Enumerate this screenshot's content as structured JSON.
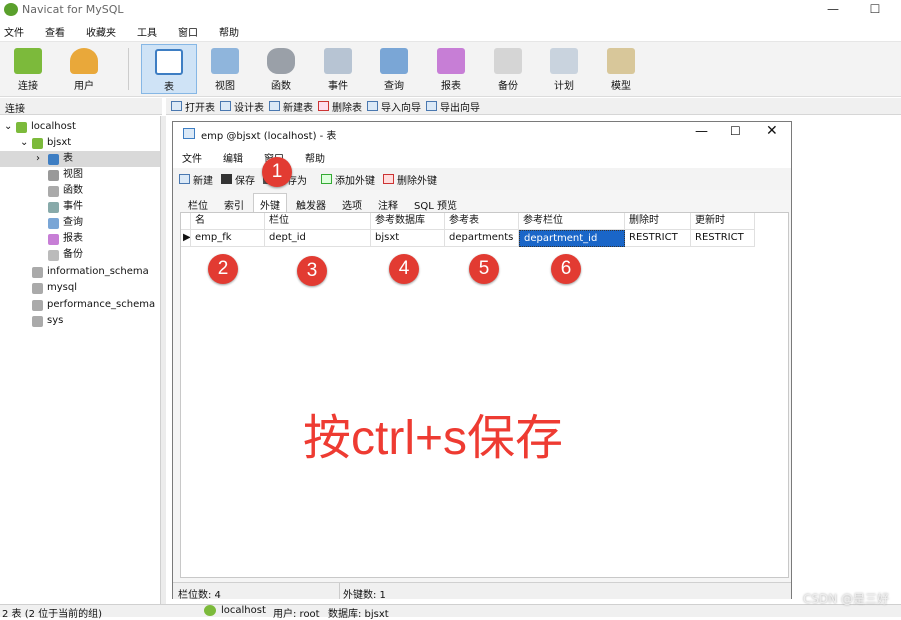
{
  "window": {
    "title": "Navicat for MySQL",
    "minimize": "—",
    "maximize": "☐"
  },
  "menu": [
    "文件",
    "查看",
    "收藏夹",
    "工具",
    "窗口",
    "帮助"
  ],
  "toolbar": [
    "连接",
    "用户",
    "表",
    "视图",
    "函数",
    "事件",
    "查询",
    "报表",
    "备份",
    "计划",
    "模型"
  ],
  "connections_header": "连接",
  "objbar": [
    "打开表",
    "设计表",
    "新建表",
    "删除表",
    "导入向导",
    "导出向导"
  ],
  "tree": {
    "localhost": "localhost",
    "bjsxt": "bjsxt",
    "table": "表",
    "view": "视图",
    "function": "函数",
    "event": "事件",
    "query": "查询",
    "report": "报表",
    "backup": "备份",
    "other_dbs": [
      "information_schema",
      "mysql",
      "performance_schema",
      "sys"
    ]
  },
  "status": {
    "left": "2 表 (2 位于当前的组)",
    "host": "localhost",
    "user": "用户: root",
    "db": "数据库: bjsxt"
  },
  "dialog": {
    "title": "emp @bjsxt (localhost) - 表",
    "menu": [
      "文件",
      "编辑",
      "窗口",
      "帮助"
    ],
    "tool_new": "新建",
    "tool_save": "保存",
    "tool_saveas": "另存为",
    "tool_addfk": "添加外键",
    "tool_delfk": "删除外键",
    "tabs": [
      "栏位",
      "索引",
      "外键",
      "触发器",
      "选项",
      "注释",
      "SQL 预览"
    ],
    "columns": [
      "名",
      "栏位",
      "参考数据库",
      "参考表",
      "参考栏位",
      "删除时",
      "更新时"
    ],
    "row": [
      "emp_fk",
      "dept_id",
      "bjsxt",
      "departments",
      "department_id",
      "RESTRICT",
      "RESTRICT"
    ],
    "status_fields": "栏位数: 4",
    "status_fk": "外键数: 1"
  },
  "annotations": {
    "badges": [
      "1",
      "2",
      "3",
      "4",
      "5",
      "6"
    ],
    "note": "按ctrl+s保存"
  },
  "watermark": "CSDN @是三好"
}
